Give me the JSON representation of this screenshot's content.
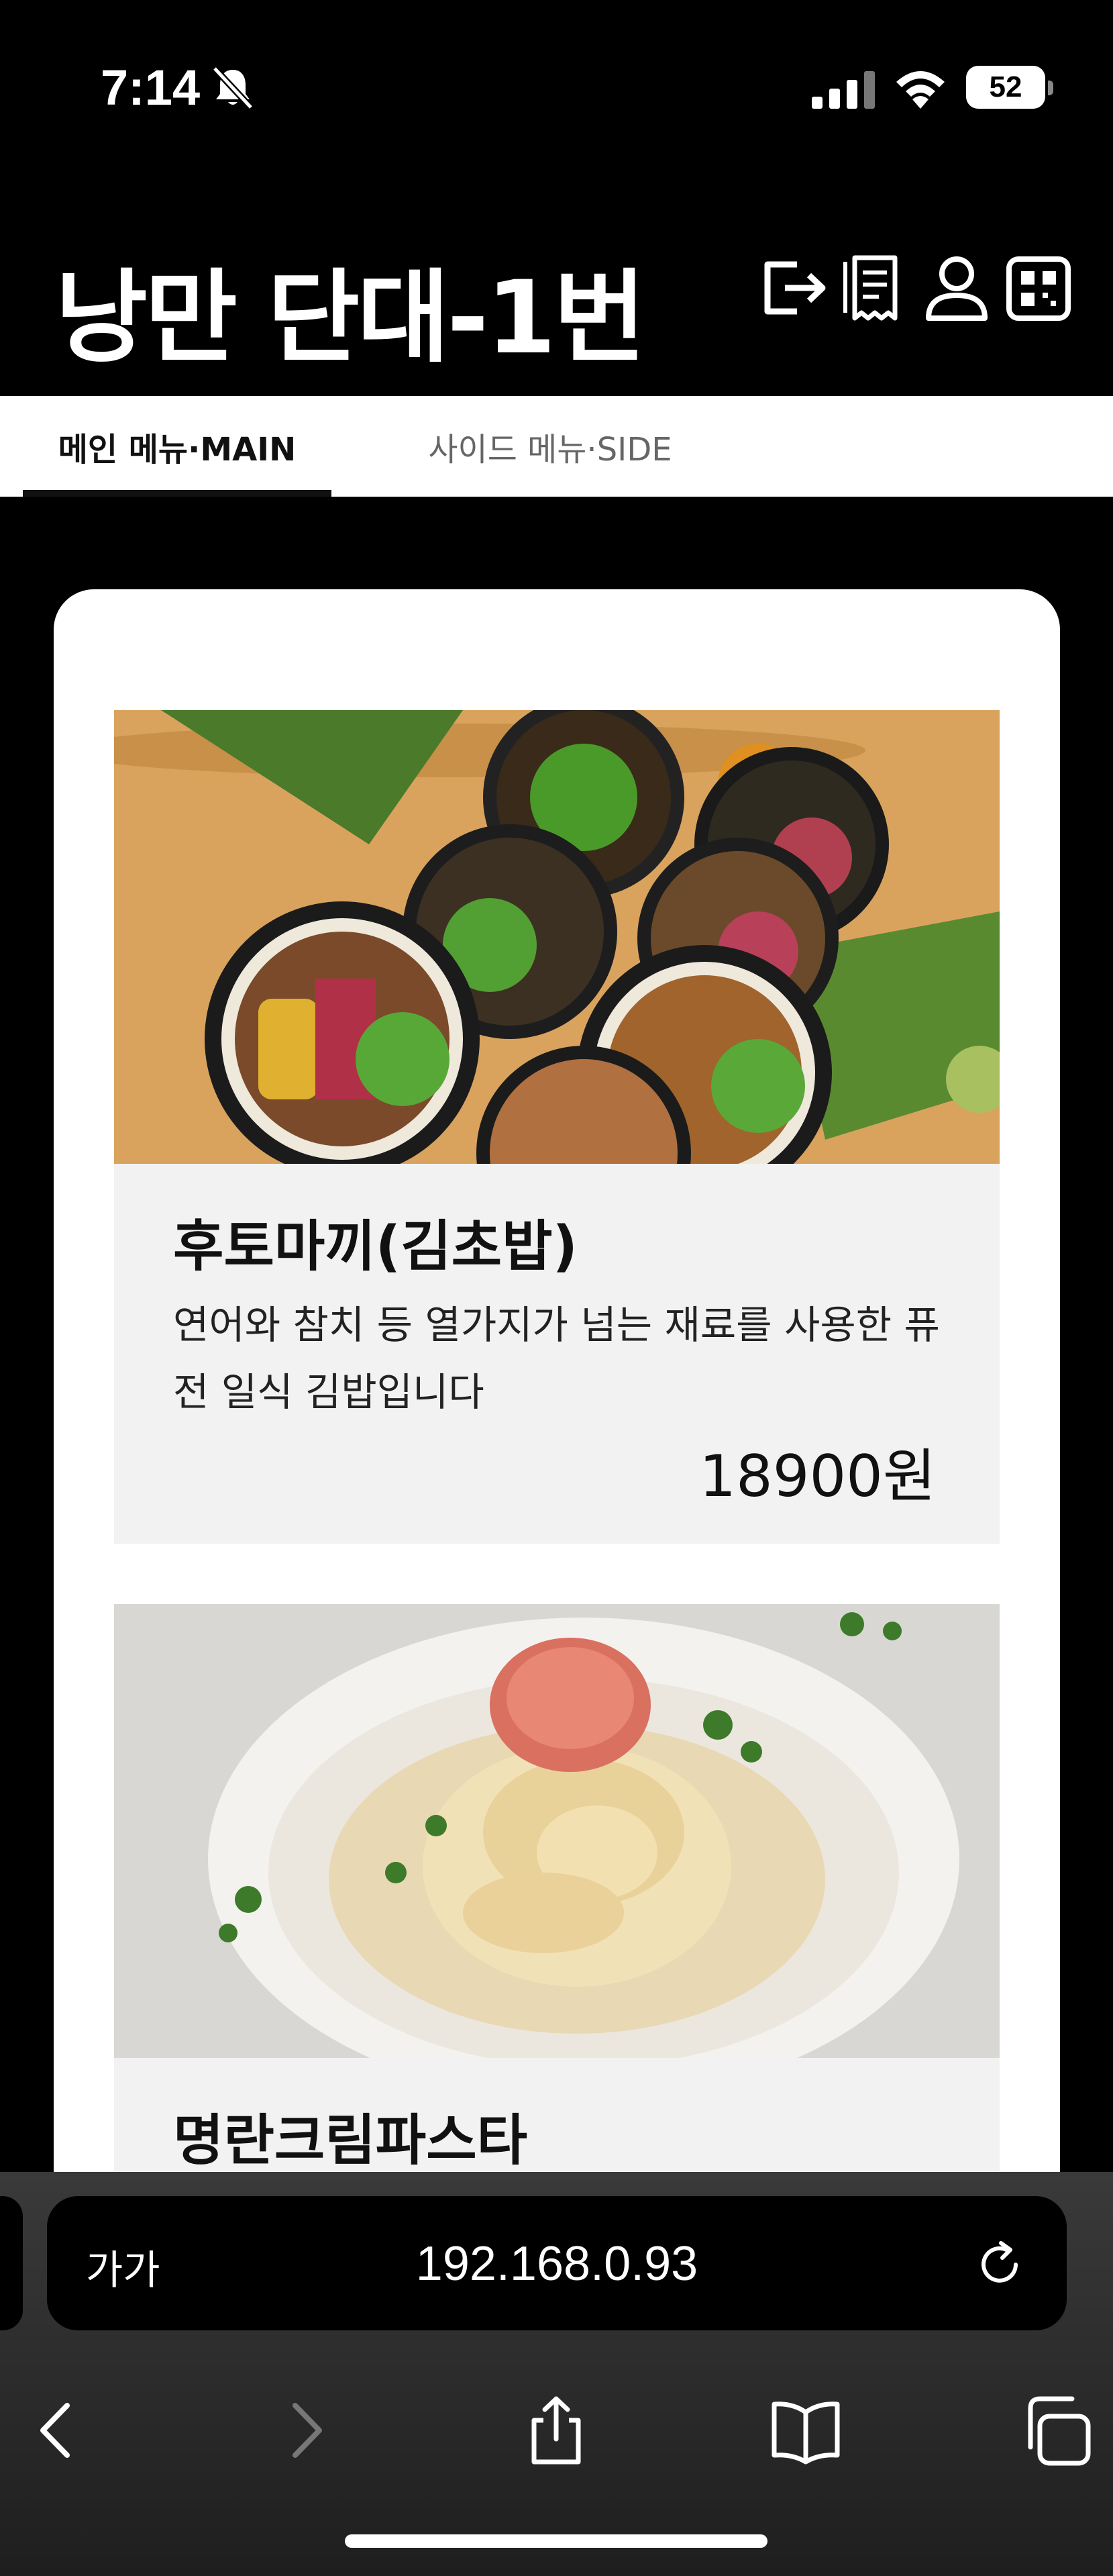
{
  "status_bar": {
    "time": "7:14",
    "battery": "52",
    "icons": [
      "bell-slash-icon",
      "cellular-signal-icon",
      "wifi-icon",
      "battery-icon"
    ]
  },
  "header": {
    "title": "낭만 단대-1번",
    "icons": [
      "logout-icon",
      "receipt-icon",
      "user-icon",
      "qr-code-icon"
    ]
  },
  "tabs": [
    {
      "label": "메인 메뉴·MAIN",
      "active": true
    },
    {
      "label": "사이드 메뉴·SIDE",
      "active": false
    }
  ],
  "menu_items": [
    {
      "name": "후토마끼(김초밥)",
      "description": "연어와 참치 등 열가지가 넘는 재료를 사용한 퓨전 일식 김밥입니다",
      "price": "18900원",
      "image": "futomaki-photo"
    },
    {
      "name": "명란크림파스타",
      "image": "mentaiko-cream-pasta-photo"
    }
  ],
  "browser": {
    "text_size_label": "가가",
    "url": "192.168.0.93",
    "toolbar_icons": [
      "back-icon",
      "forward-icon",
      "share-icon",
      "bookmarks-icon",
      "tabs-icon"
    ]
  },
  "colors": {
    "background": "#000000",
    "card": "#ffffff",
    "item_body": "#f2f2f2",
    "active_tab_underline": "#111111",
    "inactive_tab_text": "#666666"
  }
}
